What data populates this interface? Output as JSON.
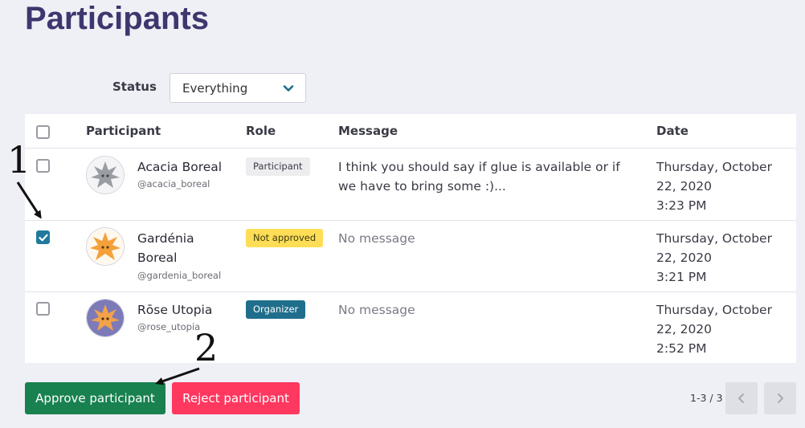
{
  "page": {
    "title": "Participants"
  },
  "filter": {
    "label": "Status",
    "value": "Everything"
  },
  "table": {
    "headers": {
      "participant": "Participant",
      "role": "Role",
      "message": "Message",
      "date": "Date"
    },
    "rows": [
      {
        "name": "Acacia Boreal",
        "handle": "@acacia_boreal",
        "role": "Participant",
        "message": "I think you should say if glue is available or if we have to bring some :)...",
        "date": "Thursday, October 22, 2020",
        "time": "3:23 PM",
        "checked": false
      },
      {
        "name": "Gardénia Boreal",
        "handle": "@gardenia_boreal",
        "role": "Not approved",
        "message": "No message",
        "date": "Thursday, October 22, 2020",
        "time": "3:21 PM",
        "checked": true
      },
      {
        "name": "Rōse Utopia",
        "handle": "@rose_utopia",
        "role": "Organizer",
        "message": "No message",
        "date": "Thursday, October 22, 2020",
        "time": "2:52 PM",
        "checked": false
      }
    ]
  },
  "actions": {
    "approve": "Approve participant",
    "reject": "Reject participant"
  },
  "pagination": {
    "label": "1-3 / 3"
  },
  "annotations": {
    "step1": "1",
    "step2": "2"
  },
  "colors": {
    "title": "#3c376e",
    "approve": "#18814f",
    "reject": "#ff3860",
    "checkbox_checked": "#1f7a9c",
    "badge_not_approved": "#ffdd57",
    "badge_organizer": "#1f6e8c"
  }
}
